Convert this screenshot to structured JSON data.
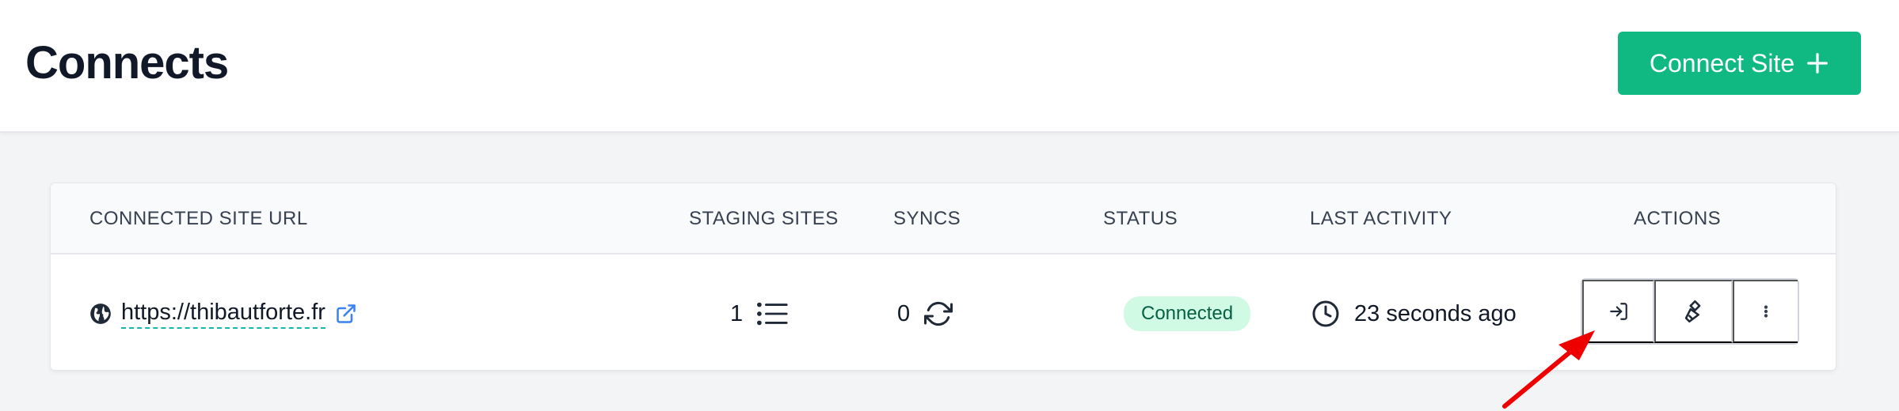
{
  "header": {
    "title": "Connects",
    "connect_button_label": "Connect Site"
  },
  "table": {
    "columns": [
      "CONNECTED SITE URL",
      "STAGING SITES",
      "SYNCS",
      "STATUS",
      "LAST ACTIVITY",
      "ACTIONS"
    ],
    "rows": [
      {
        "url": "https://thibautforte.fr",
        "staging_sites": "1",
        "syncs": "0",
        "status": "Connected",
        "last_activity": "23 seconds ago"
      }
    ]
  },
  "actions": [
    "login-icon",
    "brush-icon",
    "more-vertical-icon"
  ],
  "colors": {
    "accent": "#10b981",
    "badge_bg": "#d1fae5",
    "badge_text": "#065f46",
    "link_underline": "#14b8a6",
    "annotation_arrow": "#ef0000"
  }
}
